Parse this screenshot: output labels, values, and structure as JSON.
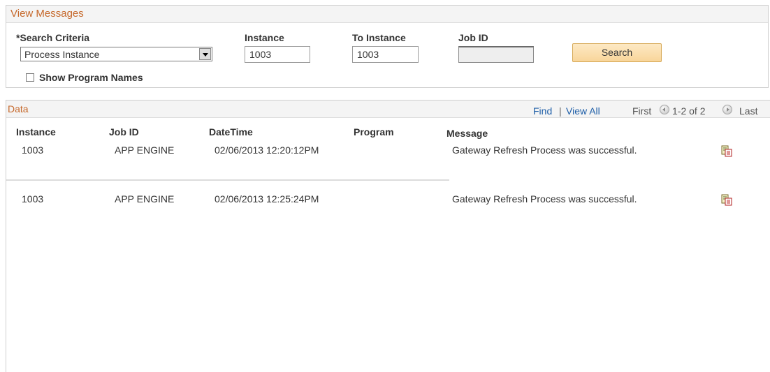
{
  "view_messages": {
    "title": "View Messages",
    "search_criteria": {
      "label": "*Search Criteria",
      "value": "Process Instance"
    },
    "instance": {
      "label": "Instance",
      "value": "1003"
    },
    "to_instance": {
      "label": "To Instance",
      "value": "1003"
    },
    "job_id": {
      "label": "Job ID",
      "value": ""
    },
    "search_button": "Search",
    "show_program_names": {
      "label": "Show Program Names",
      "checked": false
    }
  },
  "data": {
    "title": "Data",
    "nav": {
      "find": "Find",
      "separator": "|",
      "view_all": "View All",
      "first": "First",
      "range": "1-2 of 2",
      "last": "Last"
    },
    "columns": [
      "Instance",
      "Job ID",
      "DateTime",
      "Program",
      "Message"
    ],
    "rows": [
      {
        "instance": "1003",
        "job_id": "APP ENGINE",
        "datetime": "02/06/2013 12:20:12PM",
        "program": "",
        "message": "Gateway Refresh Process was successful."
      },
      {
        "instance": "1003",
        "job_id": "APP ENGINE",
        "datetime": "02/06/2013 12:25:24PM",
        "program": "",
        "message": "Gateway Refresh Process was successful."
      }
    ]
  },
  "colors": {
    "section_title": "#c6692c",
    "link": "#1f5fa8",
    "search_button_bg": "#f8d59a"
  }
}
